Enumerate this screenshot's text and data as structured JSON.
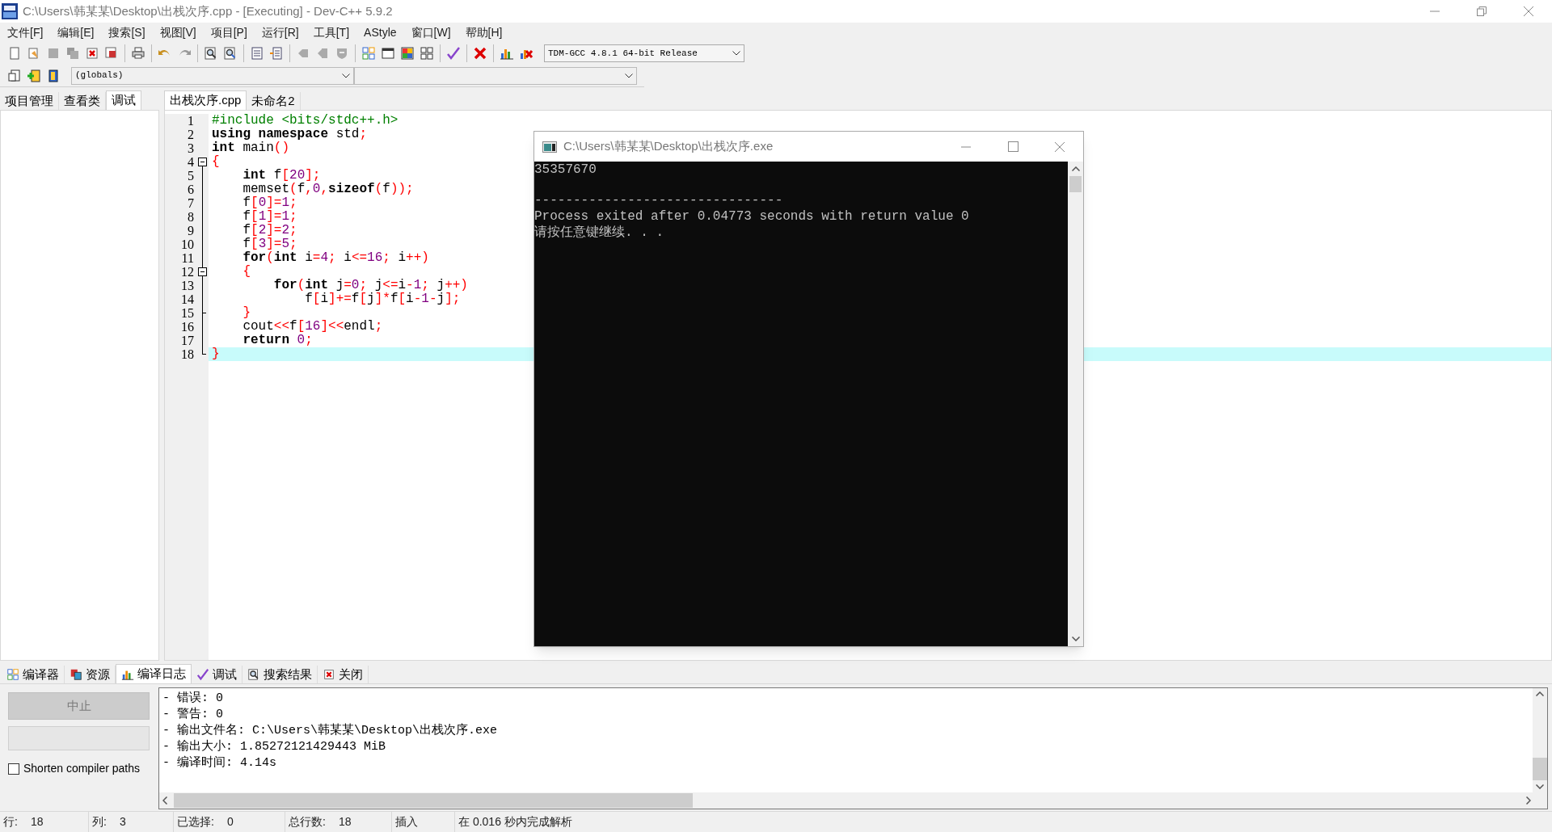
{
  "window": {
    "title": "C:\\Users\\韩某某\\Desktop\\出栈次序.cpp - [Executing] - Dev-C++ 5.9.2"
  },
  "menu": [
    "文件[F]",
    "编辑[E]",
    "搜索[S]",
    "视图[V]",
    "项目[P]",
    "运行[R]",
    "工具[T]",
    "AStyle",
    "窗口[W]",
    "帮助[H]"
  ],
  "compiler_select": {
    "value": "TDM-GCC 4.8.1 64-bit Release"
  },
  "scope_select": {
    "value": "(globals)"
  },
  "left_tabs": [
    {
      "label": "项目管理",
      "selected": false
    },
    {
      "label": "查看类",
      "selected": false
    },
    {
      "label": "调试",
      "selected": true
    }
  ],
  "editor_tabs": [
    {
      "label": "出栈次序.cpp",
      "selected": true
    },
    {
      "label": "未命名2",
      "selected": false
    }
  ],
  "code_lines": [
    {
      "number": "1",
      "fold_marker": false,
      "fold_end": false,
      "current": false,
      "tokens": [
        {
          "kind": "pre",
          "text": "#include <bits/stdc++.h>"
        }
      ]
    },
    {
      "number": "2",
      "fold_marker": false,
      "fold_end": false,
      "current": false,
      "tokens": [
        {
          "kind": "kw",
          "text": "using namespace"
        },
        {
          "kind": "plain",
          "text": " std"
        },
        {
          "kind": "sym",
          "text": ";"
        }
      ]
    },
    {
      "number": "3",
      "fold_marker": false,
      "fold_end": false,
      "current": false,
      "tokens": [
        {
          "kind": "kw",
          "text": "int"
        },
        {
          "kind": "plain",
          "text": " main"
        },
        {
          "kind": "sym",
          "text": "()"
        }
      ]
    },
    {
      "number": "4",
      "fold_marker": true,
      "fold_end": false,
      "current": false,
      "tokens": [
        {
          "kind": "sym",
          "text": "{"
        }
      ]
    },
    {
      "number": "5",
      "fold_marker": false,
      "fold_end": false,
      "current": false,
      "tokens": [
        {
          "kind": "kw",
          "text": "    int"
        },
        {
          "kind": "plain",
          "text": " f"
        },
        {
          "kind": "sym",
          "text": "["
        },
        {
          "kind": "num",
          "text": "20"
        },
        {
          "kind": "sym",
          "text": "];"
        }
      ]
    },
    {
      "number": "6",
      "fold_marker": false,
      "fold_end": false,
      "current": false,
      "tokens": [
        {
          "kind": "plain",
          "text": "    memset"
        },
        {
          "kind": "sym",
          "text": "("
        },
        {
          "kind": "plain",
          "text": "f"
        },
        {
          "kind": "sym",
          "text": ","
        },
        {
          "kind": "num",
          "text": "0"
        },
        {
          "kind": "sym",
          "text": ","
        },
        {
          "kind": "kw",
          "text": "sizeof"
        },
        {
          "kind": "sym",
          "text": "("
        },
        {
          "kind": "plain",
          "text": "f"
        },
        {
          "kind": "sym",
          "text": "));"
        }
      ]
    },
    {
      "number": "7",
      "fold_marker": false,
      "fold_end": false,
      "current": false,
      "tokens": [
        {
          "kind": "plain",
          "text": "    f"
        },
        {
          "kind": "sym",
          "text": "["
        },
        {
          "kind": "num",
          "text": "0"
        },
        {
          "kind": "sym",
          "text": "]="
        },
        {
          "kind": "num",
          "text": "1"
        },
        {
          "kind": "sym",
          "text": ";"
        }
      ]
    },
    {
      "number": "8",
      "fold_marker": false,
      "fold_end": false,
      "current": false,
      "tokens": [
        {
          "kind": "plain",
          "text": "    f"
        },
        {
          "kind": "sym",
          "text": "["
        },
        {
          "kind": "num",
          "text": "1"
        },
        {
          "kind": "sym",
          "text": "]="
        },
        {
          "kind": "num",
          "text": "1"
        },
        {
          "kind": "sym",
          "text": ";"
        }
      ]
    },
    {
      "number": "9",
      "fold_marker": false,
      "fold_end": false,
      "current": false,
      "tokens": [
        {
          "kind": "plain",
          "text": "    f"
        },
        {
          "kind": "sym",
          "text": "["
        },
        {
          "kind": "num",
          "text": "2"
        },
        {
          "kind": "sym",
          "text": "]="
        },
        {
          "kind": "num",
          "text": "2"
        },
        {
          "kind": "sym",
          "text": ";"
        }
      ]
    },
    {
      "number": "10",
      "fold_marker": false,
      "fold_end": false,
      "current": false,
      "tokens": [
        {
          "kind": "plain",
          "text": "    f"
        },
        {
          "kind": "sym",
          "text": "["
        },
        {
          "kind": "num",
          "text": "3"
        },
        {
          "kind": "sym",
          "text": "]="
        },
        {
          "kind": "num",
          "text": "5"
        },
        {
          "kind": "sym",
          "text": ";"
        }
      ]
    },
    {
      "number": "11",
      "fold_marker": false,
      "fold_end": false,
      "current": false,
      "tokens": [
        {
          "kind": "kw",
          "text": "    for"
        },
        {
          "kind": "sym",
          "text": "("
        },
        {
          "kind": "kw",
          "text": "int"
        },
        {
          "kind": "plain",
          "text": " i"
        },
        {
          "kind": "sym",
          "text": "="
        },
        {
          "kind": "num",
          "text": "4"
        },
        {
          "kind": "sym",
          "text": ";"
        },
        {
          "kind": "plain",
          "text": " i"
        },
        {
          "kind": "sym",
          "text": "<="
        },
        {
          "kind": "num",
          "text": "16"
        },
        {
          "kind": "sym",
          "text": ";"
        },
        {
          "kind": "plain",
          "text": " i"
        },
        {
          "kind": "sym",
          "text": "++)"
        }
      ]
    },
    {
      "number": "12",
      "fold_marker": true,
      "fold_end": false,
      "current": false,
      "tokens": [
        {
          "kind": "sym",
          "text": "    {"
        }
      ]
    },
    {
      "number": "13",
      "fold_marker": false,
      "fold_end": false,
      "current": false,
      "tokens": [
        {
          "kind": "kw",
          "text": "        for"
        },
        {
          "kind": "sym",
          "text": "("
        },
        {
          "kind": "kw",
          "text": "int"
        },
        {
          "kind": "plain",
          "text": " j"
        },
        {
          "kind": "sym",
          "text": "="
        },
        {
          "kind": "num",
          "text": "0"
        },
        {
          "kind": "sym",
          "text": ";"
        },
        {
          "kind": "plain",
          "text": " j"
        },
        {
          "kind": "sym",
          "text": "<="
        },
        {
          "kind": "plain",
          "text": "i"
        },
        {
          "kind": "sym",
          "text": "-"
        },
        {
          "kind": "num",
          "text": "1"
        },
        {
          "kind": "sym",
          "text": ";"
        },
        {
          "kind": "plain",
          "text": " j"
        },
        {
          "kind": "sym",
          "text": "++)"
        }
      ]
    },
    {
      "number": "14",
      "fold_marker": false,
      "fold_end": false,
      "current": false,
      "tokens": [
        {
          "kind": "plain",
          "text": "            f"
        },
        {
          "kind": "sym",
          "text": "["
        },
        {
          "kind": "plain",
          "text": "i"
        },
        {
          "kind": "sym",
          "text": "]+="
        },
        {
          "kind": "plain",
          "text": "f"
        },
        {
          "kind": "sym",
          "text": "["
        },
        {
          "kind": "plain",
          "text": "j"
        },
        {
          "kind": "sym",
          "text": "]*"
        },
        {
          "kind": "plain",
          "text": "f"
        },
        {
          "kind": "sym",
          "text": "["
        },
        {
          "kind": "plain",
          "text": "i"
        },
        {
          "kind": "sym",
          "text": "-"
        },
        {
          "kind": "num",
          "text": "1"
        },
        {
          "kind": "sym",
          "text": "-"
        },
        {
          "kind": "plain",
          "text": "j"
        },
        {
          "kind": "sym",
          "text": "];"
        }
      ]
    },
    {
      "number": "15",
      "fold_marker": false,
      "fold_end": true,
      "current": false,
      "tokens": [
        {
          "kind": "sym",
          "text": "    }"
        }
      ]
    },
    {
      "number": "16",
      "fold_marker": false,
      "fold_end": false,
      "current": false,
      "tokens": [
        {
          "kind": "plain",
          "text": "    cout"
        },
        {
          "kind": "sym",
          "text": "<<"
        },
        {
          "kind": "plain",
          "text": "f"
        },
        {
          "kind": "sym",
          "text": "["
        },
        {
          "kind": "num",
          "text": "16"
        },
        {
          "kind": "sym",
          "text": "]<<"
        },
        {
          "kind": "plain",
          "text": "endl"
        },
        {
          "kind": "sym",
          "text": ";"
        }
      ]
    },
    {
      "number": "17",
      "fold_marker": false,
      "fold_end": false,
      "current": false,
      "tokens": [
        {
          "kind": "kw",
          "text": "    return"
        },
        {
          "kind": "num",
          "text": " 0"
        },
        {
          "kind": "sym",
          "text": ";"
        }
      ]
    },
    {
      "number": "18",
      "fold_marker": false,
      "fold_end": true,
      "current": true,
      "tokens": [
        {
          "kind": "sym",
          "text": "}"
        }
      ]
    }
  ],
  "console": {
    "title": "C:\\Users\\韩某某\\Desktop\\出栈次序.exe",
    "lines": [
      {
        "kind": "output",
        "text": "35357670"
      },
      {
        "kind": "separator",
        "text": "--------------------------------"
      },
      {
        "kind": "output",
        "text": "Process exited after 0.04773 seconds with return value 0"
      },
      {
        "kind": "output",
        "text": "请按任意键继续. . ."
      }
    ]
  },
  "bottom_tabs": [
    {
      "label": "编译器",
      "kind": "compiler",
      "selected": false
    },
    {
      "label": "资源",
      "kind": "resources",
      "selected": false
    },
    {
      "label": "编译日志",
      "kind": "log",
      "selected": true
    },
    {
      "label": "调试",
      "kind": "debug",
      "selected": false
    },
    {
      "label": "搜索结果",
      "kind": "search",
      "selected": false
    },
    {
      "label": "关闭",
      "kind": "close",
      "selected": false
    }
  ],
  "abort_button": {
    "label": "中止",
    "disabled": true
  },
  "shorten_paths": {
    "label": "Shorten compiler paths",
    "checked": false
  },
  "log_lines": [
    "- 错误: 0",
    "- 警告: 0",
    "- 输出文件名: C:\\Users\\韩某某\\Desktop\\出栈次序.exe",
    "- 输出大小: 1.85272121429443 MiB",
    "- 编译时间: 4.14s"
  ],
  "status_bar": [
    {
      "label": "行:",
      "value": "18"
    },
    {
      "label": "列:",
      "value": "3"
    },
    {
      "label": "已选择:",
      "value": "0"
    },
    {
      "label": "总行数:",
      "value": "18"
    },
    {
      "label": "插入"
    },
    {
      "label": "在 0.016 秒内完成解析"
    }
  ]
}
